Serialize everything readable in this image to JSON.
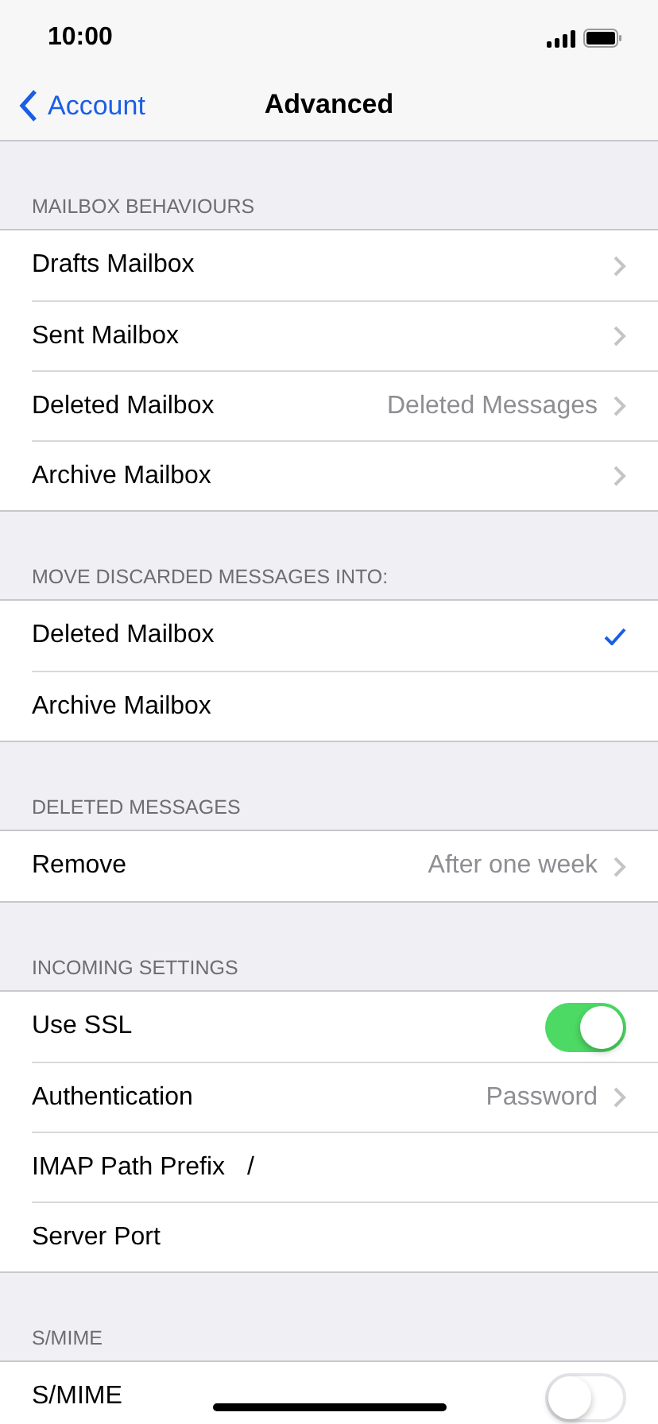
{
  "status_bar": {
    "time": "10:00"
  },
  "nav": {
    "back": "Account",
    "title": "Advanced"
  },
  "sections": [
    {
      "header": "MAILBOX BEHAVIOURS",
      "rows": [
        {
          "kind": "disclosure",
          "label": "Drafts Mailbox"
        },
        {
          "kind": "disclosure",
          "label": "Sent Mailbox"
        },
        {
          "kind": "disclosure",
          "label": "Deleted Mailbox",
          "value": "Deleted Messages"
        },
        {
          "kind": "disclosure",
          "label": "Archive Mailbox"
        }
      ]
    },
    {
      "header": "MOVE DISCARDED MESSAGES INTO:",
      "rows": [
        {
          "kind": "check",
          "label": "Deleted Mailbox",
          "selected": true
        },
        {
          "kind": "check",
          "label": "Archive Mailbox",
          "selected": false
        }
      ]
    },
    {
      "header": "DELETED MESSAGES",
      "rows": [
        {
          "kind": "disclosure",
          "label": "Remove",
          "value": "After one week"
        }
      ]
    },
    {
      "header": "INCOMING SETTINGS",
      "rows": [
        {
          "kind": "toggle",
          "label": "Use SSL",
          "on": true
        },
        {
          "kind": "disclosure",
          "label": "Authentication",
          "value": "Password"
        },
        {
          "kind": "field",
          "label": "IMAP Path Prefix",
          "value": "/"
        },
        {
          "kind": "field",
          "label": "Server Port"
        }
      ]
    },
    {
      "header": "S/MIME",
      "rows": [
        {
          "kind": "toggle",
          "label": "S/MIME",
          "on": false
        }
      ]
    }
  ]
}
